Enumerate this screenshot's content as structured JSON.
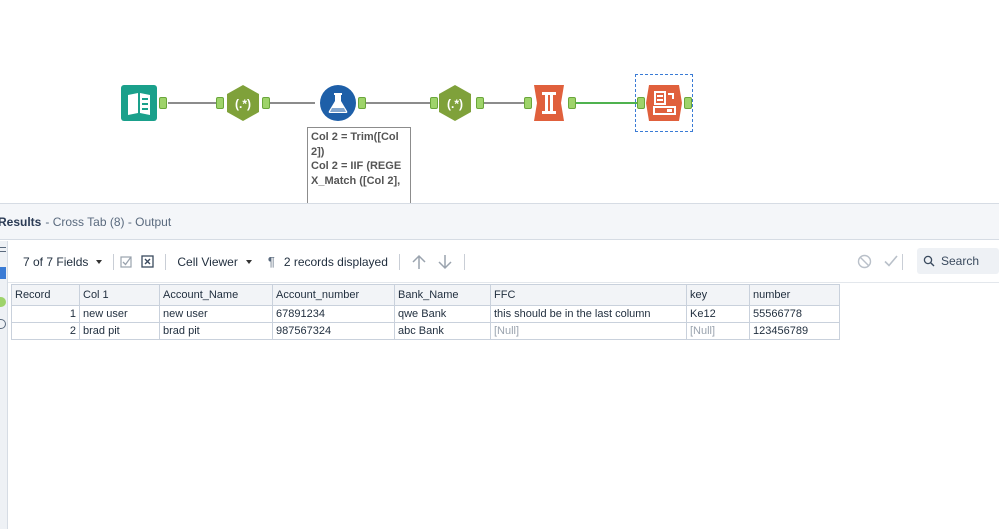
{
  "canvas": {
    "tools": [
      {
        "name": "input-data-tool",
        "icon": "book-icon",
        "color": "#1aa08b"
      },
      {
        "name": "regex-tool-1",
        "icon": "regex-icon",
        "label": "(.*)",
        "color": "#7fa13a"
      },
      {
        "name": "formula-tool",
        "icon": "flask-icon",
        "color": "#1e5fa8"
      },
      {
        "name": "regex-tool-2",
        "icon": "regex-icon",
        "label": "(.*)",
        "color": "#7fa13a"
      },
      {
        "name": "cross-tab-tool",
        "icon": "cross-tab-icon",
        "color": "#e0603c"
      },
      {
        "name": "browse-tool",
        "icon": "browse-icon",
        "color": "#e0603c"
      }
    ],
    "annotation": "Col 2 = Trim([Col 2])\nCol 2 = IIF (REGEX_Match ([Col 2],"
  },
  "results": {
    "title": "Results",
    "subtitle": "- Cross Tab (8) - Output",
    "toolbar": {
      "fields_label": "7 of 7 Fields",
      "cell_viewer_label": "Cell Viewer",
      "records_label": "2 records displayed",
      "search_label": "Search"
    },
    "columns": [
      "Record",
      "Col 1",
      "Account_Name",
      "Account_number",
      "Bank_Name",
      "FFC",
      "key",
      "number"
    ],
    "rows": [
      {
        "record": "1",
        "col1": "new user",
        "account_name": "new user",
        "account_number": "67891234",
        "bank_name": "qwe Bank",
        "ffc": "this should be in the last column",
        "key": "Ke12",
        "number": "55566778"
      },
      {
        "record": "2",
        "col1": "brad pit",
        "account_name": "brad pit",
        "account_number": "987567324",
        "bank_name": "abc Bank",
        "ffc": "[Null]",
        "key": "[Null]",
        "number": "123456789"
      }
    ]
  }
}
